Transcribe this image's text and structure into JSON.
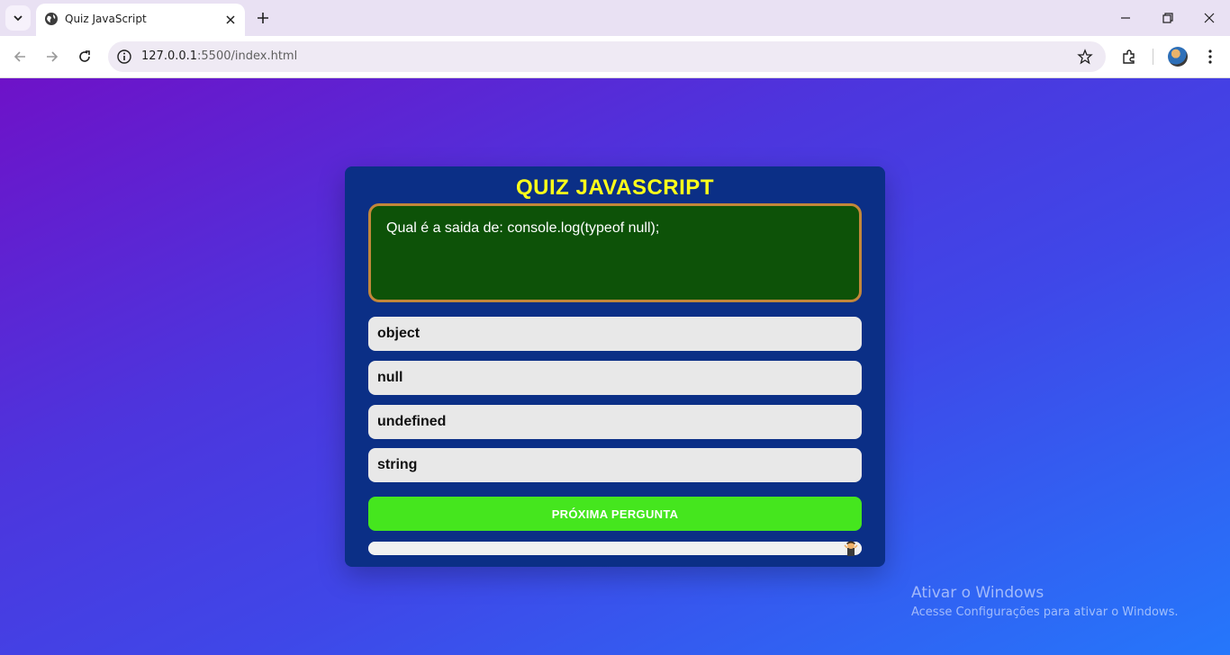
{
  "browser": {
    "tab_title": "Quiz JavaScript",
    "url_host": "127.0.0.1",
    "url_rest": ":5500/index.html",
    "icons": [
      "tab-search-icon",
      "globe-icon",
      "close-icon",
      "plus-icon",
      "minimize-icon",
      "restore-icon",
      "window-close-icon",
      "back-icon",
      "forward-icon",
      "reload-icon",
      "site-info-icon",
      "star-icon",
      "extensions-icon",
      "avatar",
      "more-icon"
    ]
  },
  "quiz": {
    "title": "QUIZ JAVASCRIPT",
    "question": "Qual é a saida de: console.log(typeof null);",
    "answers": [
      "object",
      "null",
      "undefined",
      "string"
    ],
    "next_label": "PRÓXIMA PERGUNTA",
    "progress_fraction": 1.0
  },
  "watermark": {
    "line1": "Ativar o Windows",
    "line2": "Acesse Configurações para ativar o Windows."
  },
  "colors": {
    "card": "#0b2f86",
    "title": "#ffff1a",
    "question_bg": "#0d5208",
    "question_border": "#c2873a",
    "next_button": "#45e61e"
  }
}
